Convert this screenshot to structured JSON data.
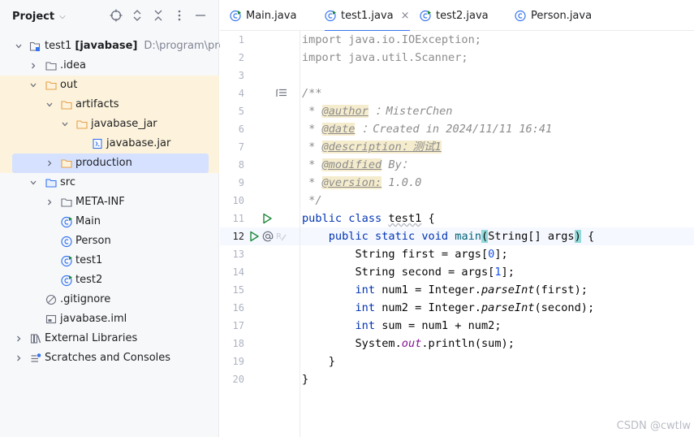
{
  "project_panel": {
    "title": "Project",
    "header_icons": [
      "locate-icon",
      "expand-all-icon",
      "collapse-all-icon",
      "options-icon",
      "minimize-icon"
    ],
    "tree": [
      {
        "label": "test1",
        "module": "[javabase]",
        "path": "D:\\program\\progra",
        "icon": "module-icon",
        "expanded": true
      },
      {
        "label": ".idea",
        "icon": "folder-icon",
        "expanded": false
      },
      {
        "label": "out",
        "icon": "folder-orange-icon",
        "expanded": true
      },
      {
        "label": "artifacts",
        "icon": "folder-orange-icon",
        "expanded": true
      },
      {
        "label": "javabase_jar",
        "icon": "folder-orange-icon",
        "expanded": true
      },
      {
        "label": "javabase.jar",
        "icon": "jar-icon"
      },
      {
        "label": "production",
        "icon": "folder-orange-icon",
        "expanded": false
      },
      {
        "label": "src",
        "icon": "source-folder-icon",
        "expanded": true
      },
      {
        "label": "META-INF",
        "icon": "folder-icon",
        "expanded": false
      },
      {
        "label": "Main",
        "icon": "runnable-class-icon"
      },
      {
        "label": "Person",
        "icon": "class-icon"
      },
      {
        "label": "test1",
        "icon": "runnable-class-icon"
      },
      {
        "label": "test2",
        "icon": "runnable-class-icon"
      },
      {
        "label": ".gitignore",
        "icon": "ignore-file-icon"
      },
      {
        "label": "javabase.iml",
        "icon": "iml-file-icon"
      },
      {
        "label": "External Libraries",
        "icon": "libraries-icon",
        "expanded": false
      },
      {
        "label": "Scratches and Consoles",
        "icon": "scratches-icon",
        "expanded": false
      }
    ]
  },
  "tabs": [
    {
      "label": "Main.java",
      "icon": "runnable-class-icon",
      "active": false
    },
    {
      "label": "test1.java",
      "icon": "runnable-class-icon",
      "active": true,
      "close": "×"
    },
    {
      "label": "test2.java",
      "icon": "runnable-class-icon",
      "active": false
    },
    {
      "label": "Person.java",
      "icon": "class-icon",
      "active": false
    }
  ],
  "editor": {
    "current_line": 12,
    "line_numbers": [
      "1",
      "2",
      "3",
      "4",
      "5",
      "6",
      "7",
      "8",
      "9",
      "10",
      "11",
      "12",
      "13",
      "14",
      "15",
      "16",
      "17",
      "18",
      "19",
      "20"
    ],
    "code": {
      "l1": {
        "kw": "import",
        "rest": " java.io.IOException;"
      },
      "l2": {
        "kw": "import",
        "rest": " java.util.Scanner;"
      },
      "l4": "/**",
      "l5": {
        "prefix": " * ",
        "tag": "@author",
        "value": " ：MisterChen"
      },
      "l6": {
        "prefix": " * ",
        "tag": "@date",
        "value": " ：Created in 2024/11/11 16:41"
      },
      "l7": {
        "prefix": " * ",
        "tag": "@description",
        "value": "：测试1"
      },
      "l8": {
        "prefix": " * ",
        "tag": "@modified",
        "value": " By："
      },
      "l9": {
        "prefix": " * ",
        "tag": "@version:",
        "value": " 1.0.0"
      },
      "l10": " */",
      "l11": {
        "kw": "public class",
        "name": "test1",
        "rest": " {"
      },
      "l12": {
        "indent": "    ",
        "kw": "public static void",
        "name": "main",
        "open": "(",
        "params": "String[] args",
        "close": ")",
        "rest": " {"
      },
      "l13": {
        "indent": "        ",
        "a": "String first = args[",
        "n": "0",
        "b": "];"
      },
      "l14": {
        "indent": "        ",
        "a": "String second = args[",
        "n": "1",
        "b": "];"
      },
      "l15": {
        "indent": "        ",
        "kw": "int",
        "a": " num1 = Integer.",
        "m": "parseInt",
        "b": "(first);"
      },
      "l16": {
        "indent": "        ",
        "kw": "int",
        "a": " num2 = Integer.",
        "m": "parseInt",
        "b": "(second);"
      },
      "l17": {
        "indent": "        ",
        "kw": "int",
        "a": " sum = num1 + num2;"
      },
      "l18": {
        "indent": "        ",
        "a": "System.",
        "f": "out",
        "b": ".println(sum);"
      },
      "l19": "    }",
      "l20": "}"
    },
    "gutter_icons": {
      "line4": "doc-comment-icon",
      "line11": "run-icon",
      "line12": [
        "run-icon",
        "annotation-at-icon",
        "edit-breakpoint-icon"
      ]
    }
  },
  "watermark": "CSDN @cwtlw",
  "colors": {
    "accent": "#3574f0",
    "selection": "#d5e1ff",
    "excluded_folder_highlight": "#fdf3dc",
    "keyword": "#0033b3",
    "comment": "#8c8c8c",
    "number": "#1750eb",
    "method_decl": "#00627a",
    "static_field": "#871094",
    "run_green": "#208a3c",
    "class_icon_blue": "#3574f0",
    "folder_orange": "#e5a04a"
  }
}
